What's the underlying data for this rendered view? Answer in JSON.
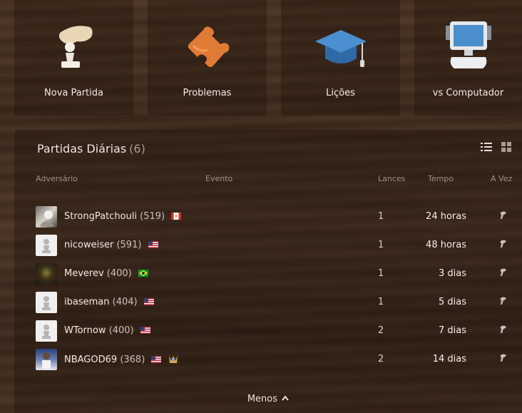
{
  "tiles": [
    {
      "label": "Nova Partida",
      "icon": "new-game-pawn-hand-icon"
    },
    {
      "label": "Problemas",
      "icon": "puzzle-piece-icon"
    },
    {
      "label": "Lições",
      "icon": "graduation-cap-icon"
    },
    {
      "label": "vs Computador",
      "icon": "computer-icon"
    }
  ],
  "panel": {
    "title": "Partidas Diárias",
    "count": "(6)",
    "headers": {
      "opponent": "Adversário",
      "event": "Evento",
      "moves": "Lances",
      "time": "Tempo",
      "turn": "A Vez"
    },
    "games": [
      {
        "name": "StrongPatchouli",
        "rating": "(519)",
        "flag": "CA",
        "moves": "1",
        "time": "24 horas"
      },
      {
        "name": "nicoweiser",
        "rating": "(591)",
        "flag": "US",
        "moves": "1",
        "time": "48 horas"
      },
      {
        "name": "Meverev",
        "rating": "(400)",
        "flag": "BR",
        "moves": "1",
        "time": "3 dias"
      },
      {
        "name": "ibaseman",
        "rating": "(404)",
        "flag": "US",
        "moves": "1",
        "time": "5 dias"
      },
      {
        "name": "WTornow",
        "rating": "(400)",
        "flag": "US",
        "moves": "2",
        "time": "7 dias"
      },
      {
        "name": "NBAGOD69",
        "rating": "(368)",
        "flag": "US",
        "moves": "2",
        "time": "14 dias"
      }
    ],
    "less_label": "Menos"
  },
  "colors": {
    "wood_dark": "#3f2a1c",
    "puzzle_orange": "#e07b36",
    "cap_blue": "#3f7fbf"
  }
}
